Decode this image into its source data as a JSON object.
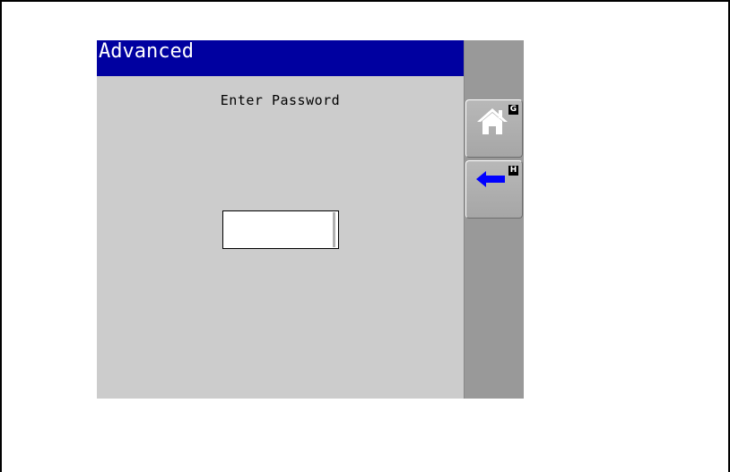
{
  "screen": {
    "title": "Advanced",
    "prompt": "Enter Password",
    "password_value": ""
  },
  "softkeys": [
    {
      "icon": "home-icon",
      "key_letter": "G"
    },
    {
      "icon": "back-arrow-icon",
      "key_letter": "H"
    }
  ],
  "colors": {
    "title_bar": "#0000a0",
    "screen_bg": "#cccccc",
    "side_panel": "#999999",
    "arrow": "#0000ff"
  }
}
